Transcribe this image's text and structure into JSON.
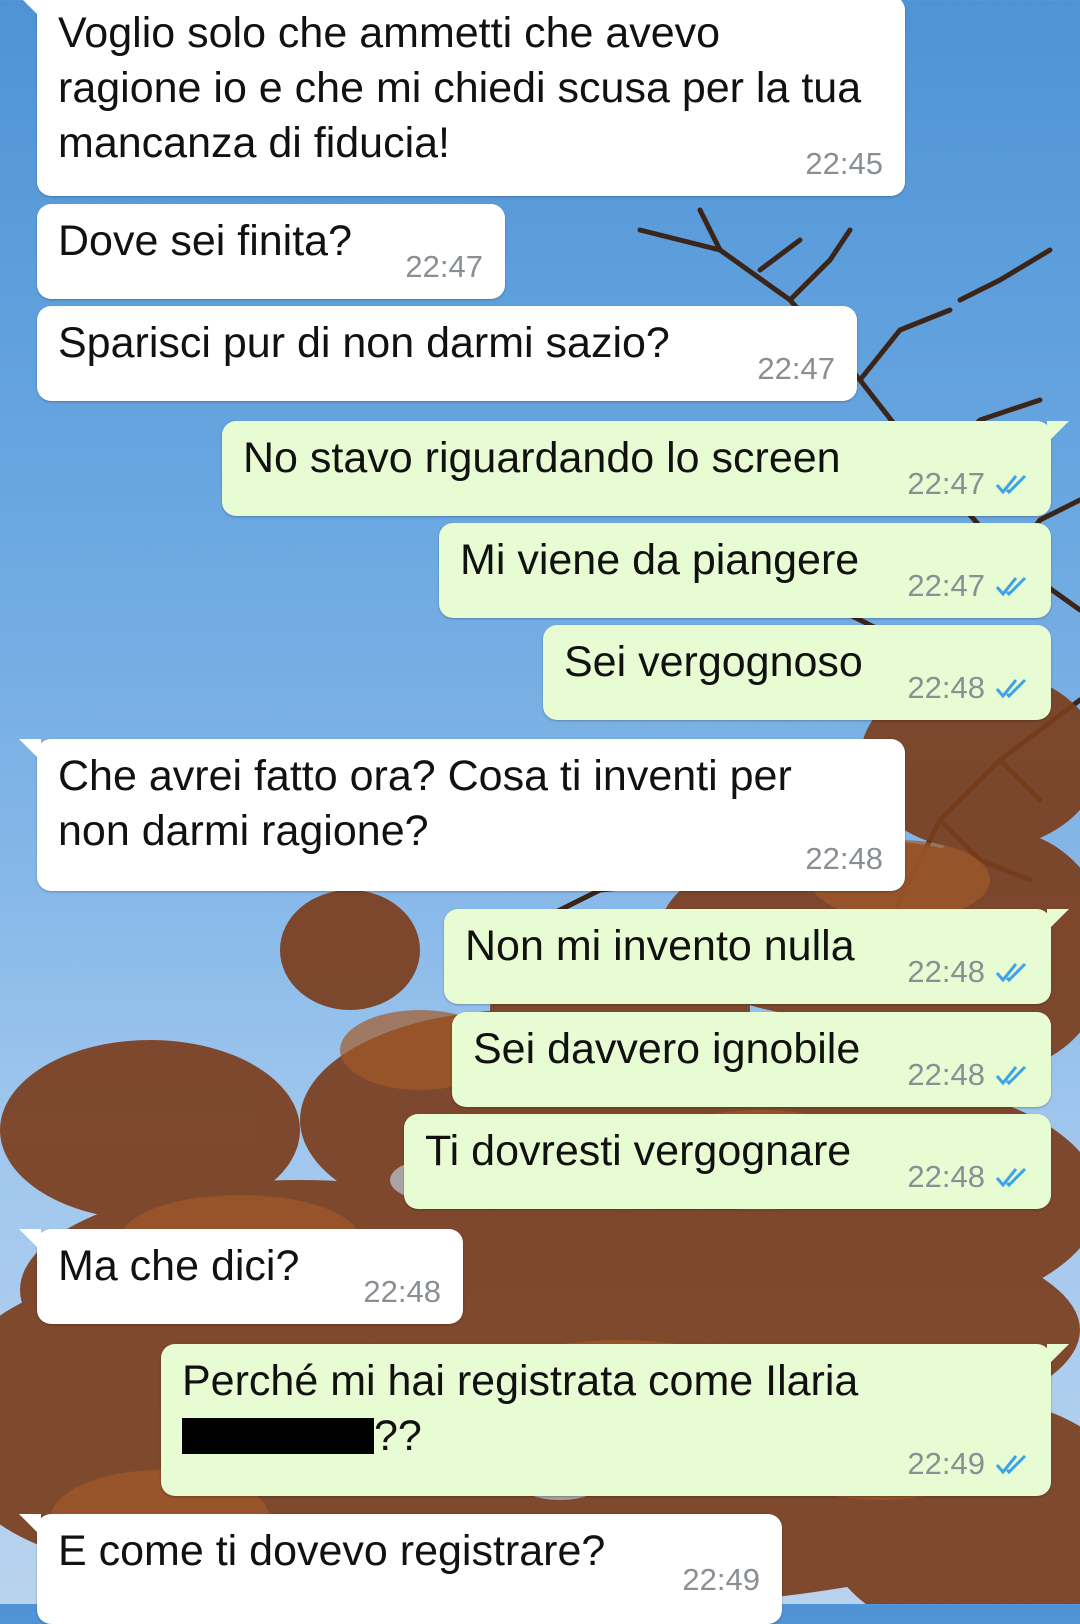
{
  "colors": {
    "incoming_bubble": "#ffffff",
    "outgoing_bubble": "#e7fcd3",
    "timestamp": "#8a8f94",
    "read_ticks": "#3ea3e6",
    "sky": "#6ea8e0",
    "foliage": "#7b3e1d"
  },
  "icons": {
    "read_receipt": "double-check-icon"
  },
  "messages": [
    {
      "direction": "incoming",
      "lines": [
        "Voglio solo che ammetti che avevo",
        "ragione io e che mi chiedi scusa per la tua",
        "mancanza di fiducia!"
      ],
      "time": "22:45"
    },
    {
      "direction": "incoming",
      "lines": [
        "Dove sei finita?"
      ],
      "time": "22:47"
    },
    {
      "direction": "incoming",
      "lines": [
        "Sparisci pur di non darmi sazio?"
      ],
      "time": "22:47"
    },
    {
      "direction": "outgoing",
      "lines": [
        "No stavo riguardando lo screen"
      ],
      "time": "22:47"
    },
    {
      "direction": "outgoing",
      "lines": [
        "Mi viene da piangere"
      ],
      "time": "22:47"
    },
    {
      "direction": "outgoing",
      "lines": [
        "Sei vergognoso"
      ],
      "time": "22:48"
    },
    {
      "direction": "incoming",
      "lines": [
        "Che avrei fatto ora? Cosa ti inventi per",
        "non darmi ragione?"
      ],
      "time": "22:48"
    },
    {
      "direction": "outgoing",
      "lines": [
        "Non mi invento nulla"
      ],
      "time": "22:48"
    },
    {
      "direction": "outgoing",
      "lines": [
        "Sei davvero ignobile"
      ],
      "time": "22:48"
    },
    {
      "direction": "outgoing",
      "lines": [
        "Ti dovresti vergognare"
      ],
      "time": "22:48"
    },
    {
      "direction": "incoming",
      "lines": [
        "Ma che dici?"
      ],
      "time": "22:48"
    },
    {
      "direction": "outgoing",
      "lines": [
        "Perché mi hai registrata come Ilaria",
        "??"
      ],
      "time": "22:49",
      "redacted_line": 1
    },
    {
      "direction": "incoming",
      "lines": [
        "E come ti dovevo registrare?"
      ],
      "time": "22:49"
    }
  ]
}
